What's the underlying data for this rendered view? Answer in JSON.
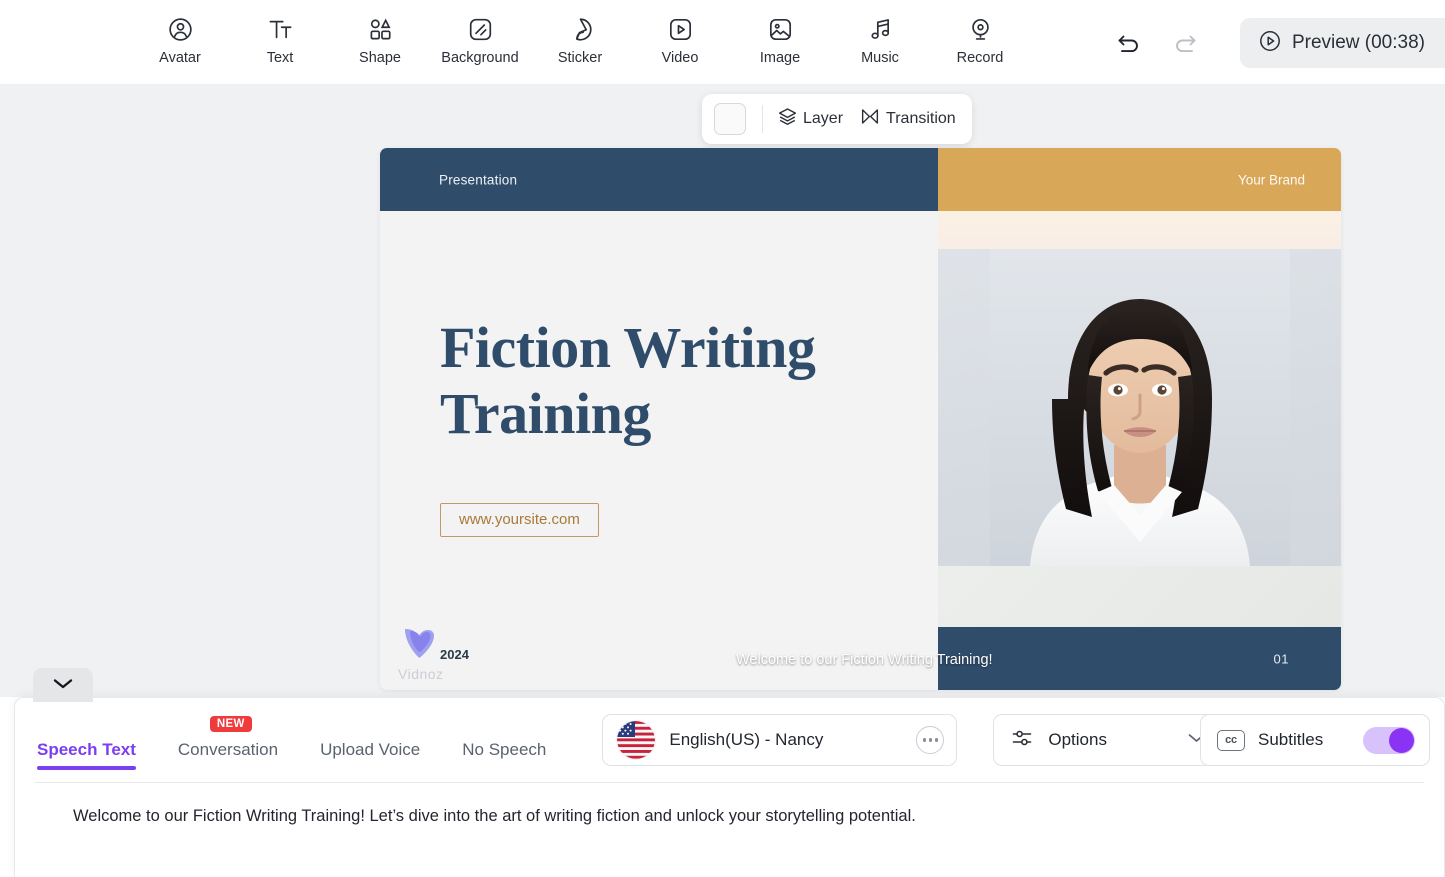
{
  "toolbar": {
    "items": [
      {
        "label": "Avatar",
        "icon": "avatar-icon"
      },
      {
        "label": "Text",
        "icon": "text-icon"
      },
      {
        "label": "Shape",
        "icon": "shape-icon"
      },
      {
        "label": "Background",
        "icon": "background-icon"
      },
      {
        "label": "Sticker",
        "icon": "sticker-icon"
      },
      {
        "label": "Video",
        "icon": "video-icon"
      },
      {
        "label": "Image",
        "icon": "image-icon"
      },
      {
        "label": "Music",
        "icon": "music-icon"
      },
      {
        "label": "Record",
        "icon": "record-icon"
      }
    ],
    "undo_icon": "undo-icon",
    "redo_icon": "redo-icon",
    "preview_label": "Preview (00:38)",
    "preview_icon": "play-circle-icon"
  },
  "layer_bar": {
    "swatch_color": "#fafafa",
    "layer_label": "Layer",
    "layer_icon": "layers-icon",
    "transition_label": "Transition",
    "transition_icon": "transition-icon"
  },
  "slide": {
    "header_label": "Presentation",
    "brand_label": "Your Brand",
    "title": "Fiction Writing Training",
    "url_label": "www.yoursite.com",
    "year": "2024",
    "watermark": "Vidnoz",
    "page_number": "01",
    "subtitle_overlay": "Welcome to our Fiction Writing Training!",
    "colors": {
      "navy": "#2f4c6b",
      "gold": "#d8a757",
      "accent_brown": "#a9793c",
      "canvas_bg": "#f2f3f2"
    }
  },
  "collapse": {
    "icon": "chevron-down-icon"
  },
  "bottom_panel": {
    "tabs": [
      {
        "label": "Speech Text",
        "active": true,
        "badge": ""
      },
      {
        "label": "Conversation",
        "active": false,
        "badge": "NEW"
      },
      {
        "label": "Upload Voice",
        "active": false,
        "badge": ""
      },
      {
        "label": "No Speech",
        "active": false,
        "badge": ""
      }
    ],
    "voice": {
      "name": "English(US) - Nancy",
      "flag": "us-flag-icon",
      "more_icon": "more-dots-icon"
    },
    "options": {
      "label": "Options",
      "icon": "sliders-icon",
      "chevron": "chevron-down-icon"
    },
    "subtitles": {
      "label": "Subtitles",
      "icon": "cc-icon",
      "enabled": true,
      "on_color": "#8b33f5"
    },
    "speech_text": "Welcome to our Fiction Writing Training! Let’s dive into the art of writing fiction and unlock your storytelling potential.",
    "active_tab_color": "#7b3ff2"
  }
}
